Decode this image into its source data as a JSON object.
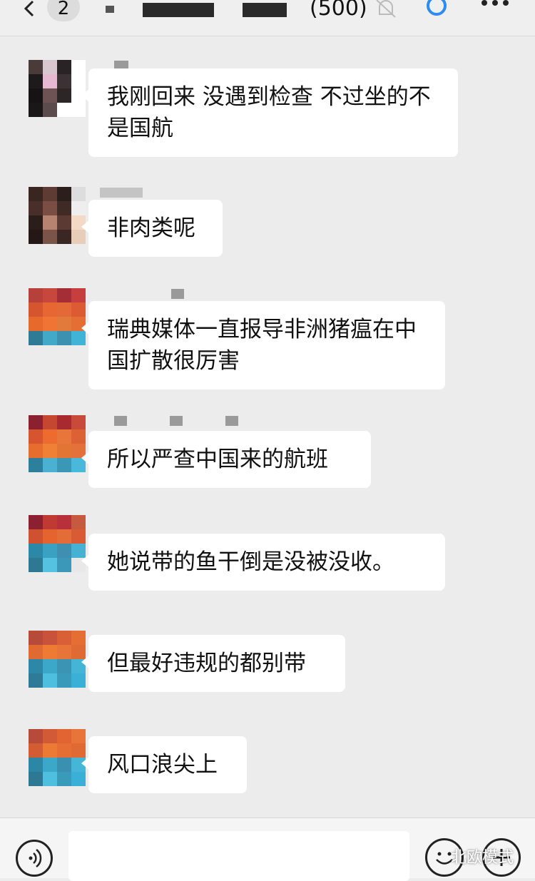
{
  "header": {
    "unread_count": "2",
    "member_count": "(500)"
  },
  "messages": [
    {
      "text": "我刚回来 没遇到检查 不过坐的不是国航"
    },
    {
      "text": "非肉类呢"
    },
    {
      "text": "瑞典媒体一直报导非洲猪瘟在中国扩散很厉害"
    },
    {
      "text": "所以严查中国来的航班"
    },
    {
      "text": "她说带的鱼干倒是没被没收。"
    },
    {
      "text": "但最好违规的都别带"
    },
    {
      "text": "风口浪尖上"
    }
  ],
  "watermark": "北欧模式",
  "colors": {
    "background": "#ececec",
    "bubble": "#ffffff",
    "accent_ring": "#2d8cf0"
  },
  "icons": [
    "back-icon",
    "mute-bell-icon",
    "more-icon",
    "voice-icon",
    "emoji-icon",
    "plus-icon"
  ]
}
